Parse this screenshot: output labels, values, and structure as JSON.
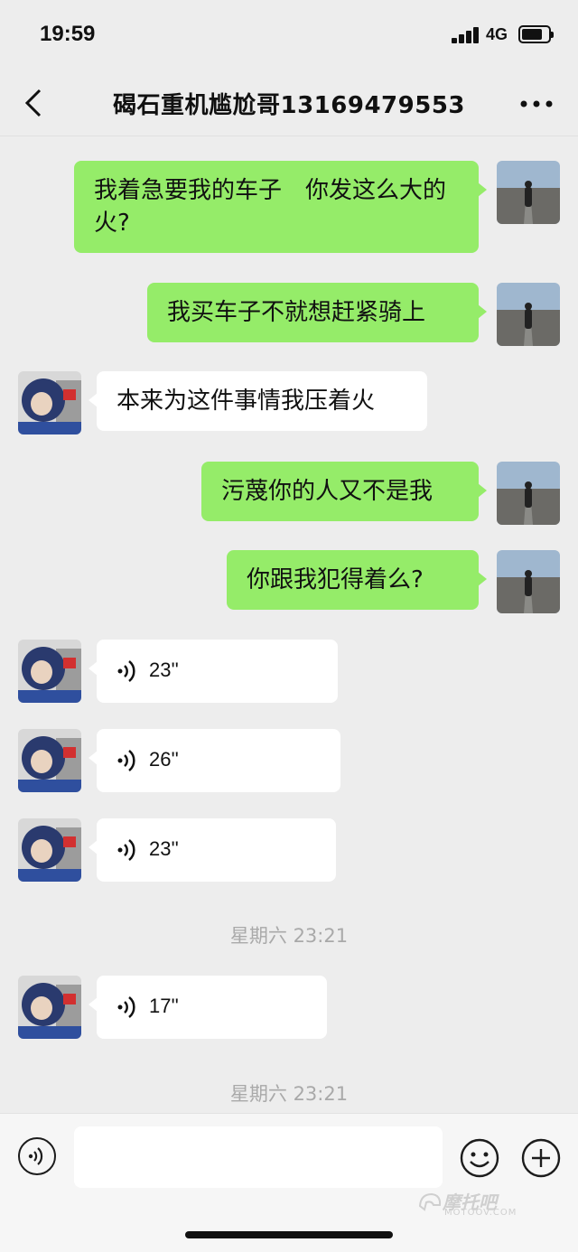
{
  "status_bar": {
    "time": "19:59",
    "network": "4G",
    "battery_level": 0.8
  },
  "header": {
    "title": "碣石重机尴尬哥13169479553",
    "back_icon": "chevron-left-icon",
    "more_icon": "more-dots-icon"
  },
  "messages": [
    {
      "sender": "self",
      "type": "text",
      "text": "我着急要我的车子　你发这么大的火?"
    },
    {
      "sender": "self",
      "type": "text",
      "text": "我买车子不就想赶紧骑上"
    },
    {
      "sender": "other",
      "type": "text",
      "text": "本来为这件事情我压着火"
    },
    {
      "sender": "self",
      "type": "text",
      "text": "污蔑你的人又不是我"
    },
    {
      "sender": "self",
      "type": "text",
      "text": "你跟我犯得着么?"
    },
    {
      "sender": "other",
      "type": "voice",
      "duration": "23''"
    },
    {
      "sender": "other",
      "type": "voice",
      "duration": "26''"
    },
    {
      "sender": "other",
      "type": "voice",
      "duration": "23''"
    },
    {
      "sender": "other",
      "type": "voice",
      "duration": "17''"
    }
  ],
  "timestamps": [
    "星期六 23:21",
    "星期六 23:21"
  ],
  "input_bar": {
    "placeholder": "",
    "voice_icon": "voice-toggle-icon",
    "emoji_icon": "emoji-icon",
    "plus_icon": "plus-icon"
  },
  "watermark": {
    "text": "摩托吧",
    "sub": "MOTOOV.COM"
  },
  "colors": {
    "self_bubble": "#95ec69",
    "other_bubble": "#ffffff",
    "background": "#ededed"
  }
}
